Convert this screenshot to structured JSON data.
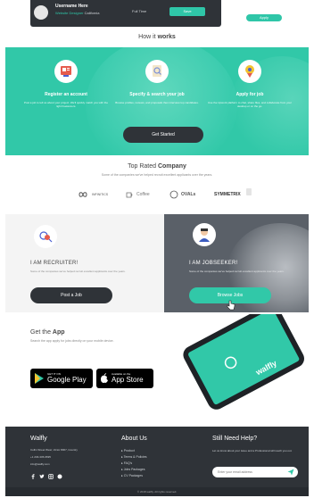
{
  "top": {
    "name": "Username Here",
    "subtitle_accent": "Website Designer",
    "subtitle_rest": "California",
    "meta": "Full Time",
    "button": "Save",
    "right_button": "Apply"
  },
  "how": {
    "title_light": "How it ",
    "title_bold": "works",
    "steps": [
      {
        "title": "Register an account",
        "desc": "Post a job to tell us about your project. We'll quickly match you with the right freelancers.",
        "icon": "register-icon"
      },
      {
        "title": "Specify & search your job",
        "desc": "Browse profiles, reviews, and proposals then interview top candidates.",
        "icon": "search-job-icon"
      },
      {
        "title": "Apply for job",
        "desc": "Use the Upwork platform to chat, share files, and collaborate from your desktop or on the go.",
        "icon": "apply-icon"
      }
    ],
    "button": "Get Started"
  },
  "rated": {
    "title_light": "Top Rated ",
    "title_bold": "Company",
    "subtitle": "Some of the companies we've helped recruit excellent applicants over the years.",
    "companies": [
      "INFINITICS",
      "Coffee",
      "OVALs",
      "SYMMETRIX"
    ]
  },
  "recruiter": {
    "title": "I AM RECRUITER!",
    "desc": "Some of the companies we've helped recruit excellent applicants over the years.",
    "button": "Post a Job"
  },
  "seeker": {
    "title": "I AM JOBSEEKER!",
    "desc": "Some of the companies we've helped recruit excellent applicants over the years.",
    "button": "Browse Jobs"
  },
  "app": {
    "title_light": "Get the ",
    "title_bold": "App",
    "subtitle": "Search the app apply for jobs directly on your mobile device.",
    "google_small": "GET IT ON",
    "google_big": "Google Play",
    "apple_small": "Available on the",
    "apple_big": "App Store",
    "phone_brand": "walfly"
  },
  "footer": {
    "brand": "Walfly",
    "address": "Collin Street West, Victor 8007, Country",
    "phone": "+1 246-345-0695",
    "email": "info@walfly.com",
    "about_title": "About Us",
    "links": [
      "Product",
      "Terms & Policies",
      "FAQ's",
      "Jobs Packages",
      "CV Packages"
    ],
    "help_title": "Still Need Help?",
    "help_text": "Let us know about your issue and a Professional will reach you out.",
    "email_placeholder": "Enter your email address",
    "copyright": "© 2018 walfly. All rights reserved."
  },
  "colors": {
    "accent": "#31c8a8",
    "dark": "#2f3338"
  }
}
